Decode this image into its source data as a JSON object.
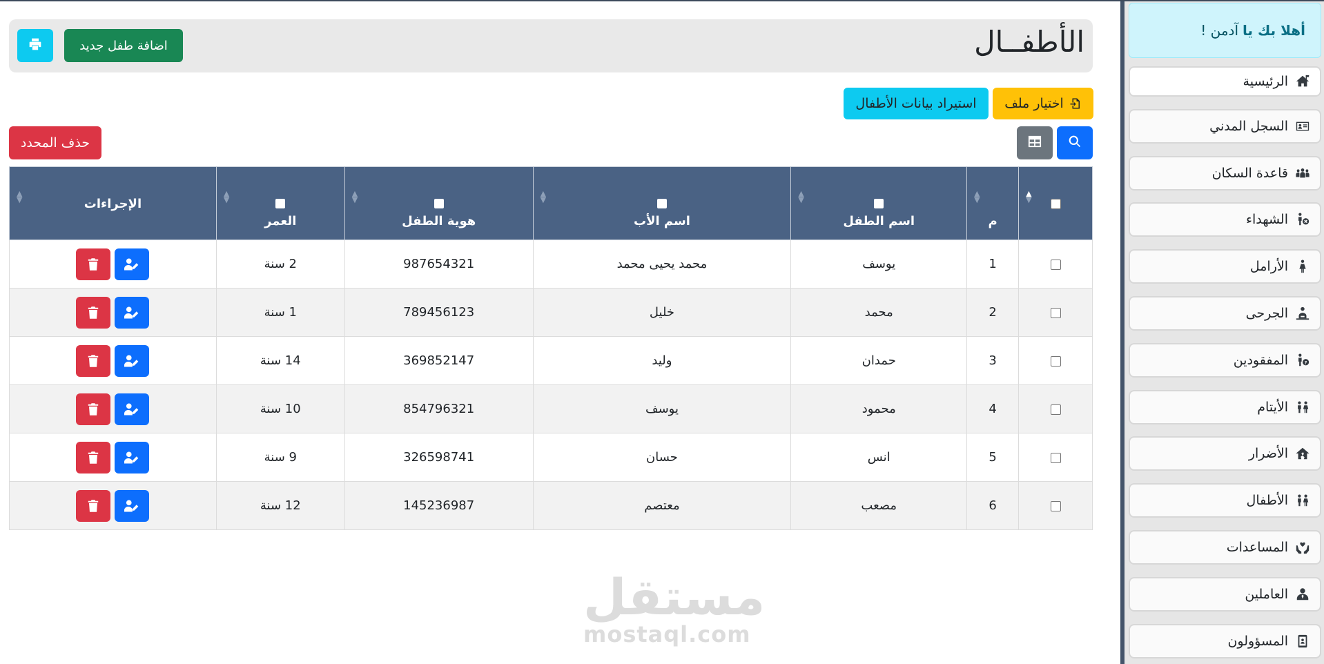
{
  "sidebar": {
    "welcome_prefix": "أهلا بك يا",
    "welcome_user": "آدمن !",
    "items": [
      {
        "label": "الرئيسية",
        "icon": "house-flag-icon"
      },
      {
        "label": "السجل المدني",
        "icon": "id-card-icon"
      },
      {
        "label": "قاعدة السكان",
        "icon": "people-group-icon"
      },
      {
        "label": "الشهداء",
        "icon": "person-x-icon"
      },
      {
        "label": "الأرامل",
        "icon": "person-dress-icon"
      },
      {
        "label": "الجرحى",
        "icon": "person-injured-icon"
      },
      {
        "label": "المفقودين",
        "icon": "person-question-icon"
      },
      {
        "label": "الأيتام",
        "icon": "children-icon"
      },
      {
        "label": "الأضرار",
        "icon": "house-damage-icon"
      },
      {
        "label": "الأطفال",
        "icon": "children-icon"
      },
      {
        "label": "المساعدات",
        "icon": "hands-holding-icon"
      },
      {
        "label": "العاملين",
        "icon": "user-tie-icon"
      },
      {
        "label": "المسؤولون",
        "icon": "id-badge-icon"
      }
    ]
  },
  "header": {
    "title": "الأطفــال",
    "add_label": "اضافة طفل جديد"
  },
  "toolbar": {
    "choose_file_label": "اختيار ملف",
    "import_label": "استيراد بيانات الأطفال",
    "delete_selected_label": "حذف المحدد"
  },
  "table": {
    "columns": [
      "م",
      "اسم الطفل",
      "اسم الأب",
      "هوية الطفل",
      "العمر",
      "الإجراءات"
    ],
    "rows": [
      {
        "n": "1",
        "child": "يوسف",
        "father": "محمد يحيى محمد",
        "id": "987654321",
        "age": "2 سنة"
      },
      {
        "n": "2",
        "child": "محمد",
        "father": "خليل",
        "id": "789456123",
        "age": "1 سنة"
      },
      {
        "n": "3",
        "child": "حمدان",
        "father": "وليد",
        "id": "369852147",
        "age": "14 سنة"
      },
      {
        "n": "4",
        "child": "محمود",
        "father": "يوسف",
        "id": "854796321",
        "age": "10 سنة"
      },
      {
        "n": "5",
        "child": "انس",
        "father": "حسان",
        "id": "326598741",
        "age": "9 سنة"
      },
      {
        "n": "6",
        "child": "مصعب",
        "father": "معتصم",
        "id": "145236987",
        "age": "12 سنة"
      }
    ]
  },
  "watermark": {
    "arabic": "مستقل",
    "latin": "mostaql.com"
  }
}
